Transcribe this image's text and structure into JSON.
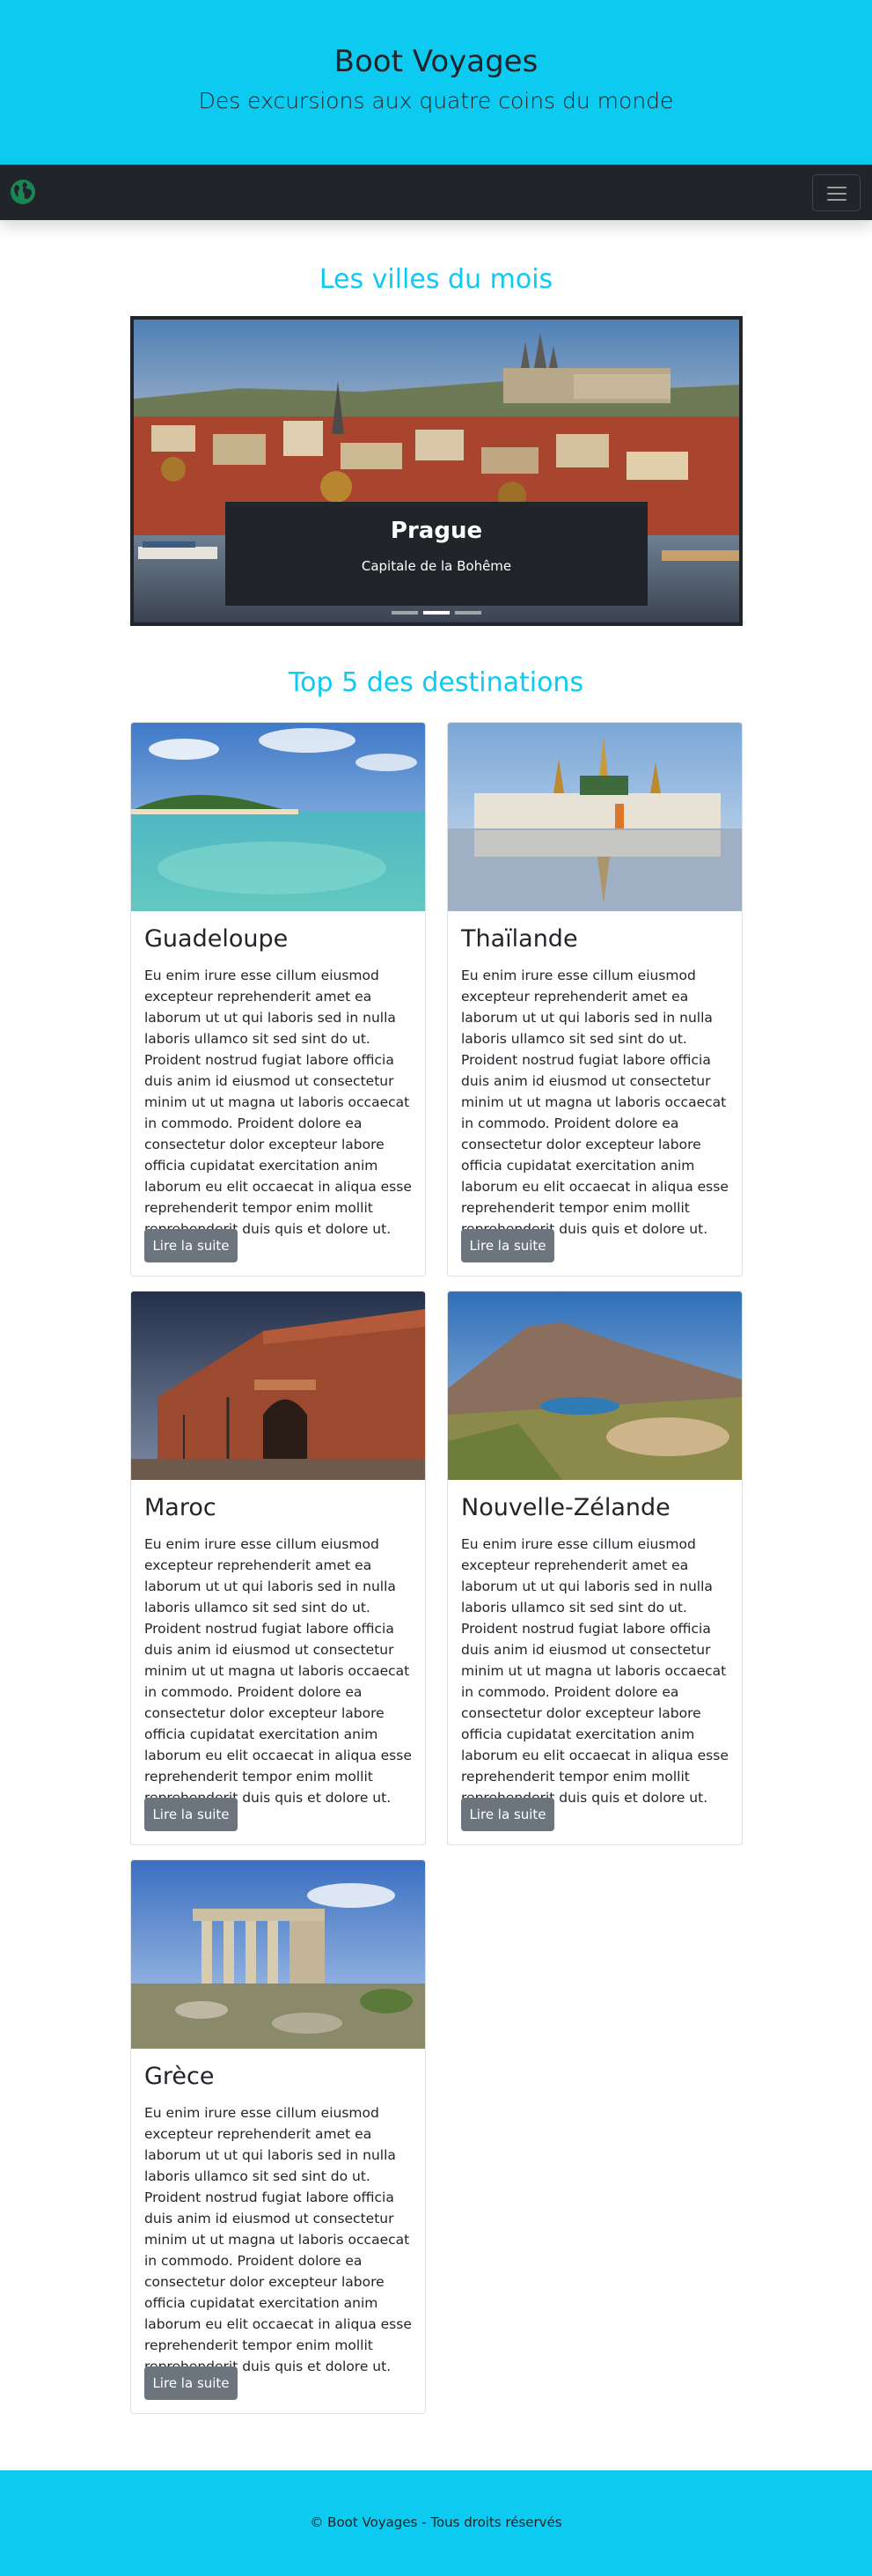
{
  "header": {
    "title": "Boot Voyages",
    "subtitle": "Des excursions aux quatre coins du monde"
  },
  "navbar": {
    "brand_icon": "globe-icon",
    "toggler_icon": "hamburger-menu-icon",
    "colors": {
      "background": "#212529",
      "brand": "#198754"
    }
  },
  "carousel": {
    "section_title": "Les villes du mois",
    "slide": {
      "title": "Prague",
      "caption": "Capitale de la Bohême"
    },
    "slides_count": 3,
    "active_index": 1
  },
  "destinations": {
    "section_title": "Top 5 des destinations",
    "cards": [
      {
        "title": "Guadeloupe",
        "text": "Eu enim irure esse cillum eiusmod excepteur reprehenderit amet ea laborum ut ut qui laboris sed in nulla laboris ullamco sit sed sint do ut. Proident nostrud fugiat labore officia duis anim id eiusmod ut consectetur minim ut ut magna ut laboris occaecat in commodo. Proident dolore ea consectetur dolor excepteur labore officia cupidatat exercitation anim laborum eu elit occaecat in aliqua esse reprehenderit tempor enim mollit reprehenderit duis quis et dolore ut.",
        "button": "Lire la suite"
      },
      {
        "title": "Thaïlande",
        "text": "Eu enim irure esse cillum eiusmod excepteur reprehenderit amet ea laborum ut ut qui laboris sed in nulla laboris ullamco sit sed sint do ut. Proident nostrud fugiat labore officia duis anim id eiusmod ut consectetur minim ut ut magna ut laboris occaecat in commodo. Proident dolore ea consectetur dolor excepteur labore officia cupidatat exercitation anim laborum eu elit occaecat in aliqua esse reprehenderit tempor enim mollit reprehenderit duis quis et dolore ut.",
        "button": "Lire la suite"
      },
      {
        "title": "Maroc",
        "text": "Eu enim irure esse cillum eiusmod excepteur reprehenderit amet ea laborum ut ut qui laboris sed in nulla laboris ullamco sit sed sint do ut. Proident nostrud fugiat labore officia duis anim id eiusmod ut consectetur minim ut ut magna ut laboris occaecat in commodo. Proident dolore ea consectetur dolor excepteur labore officia cupidatat exercitation anim laborum eu elit occaecat in aliqua esse reprehenderit tempor enim mollit reprehenderit duis quis et dolore ut.",
        "button": "Lire la suite"
      },
      {
        "title": "Nouvelle-Zélande",
        "text": "Eu enim irure esse cillum eiusmod excepteur reprehenderit amet ea laborum ut ut qui laboris sed in nulla laboris ullamco sit sed sint do ut. Proident nostrud fugiat labore officia duis anim id eiusmod ut consectetur minim ut ut magna ut laboris occaecat in commodo. Proident dolore ea consectetur dolor excepteur labore officia cupidatat exercitation anim laborum eu elit occaecat in aliqua esse reprehenderit tempor enim mollit reprehenderit duis quis et dolore ut.",
        "button": "Lire la suite"
      },
      {
        "title": "Grèce",
        "text": "Eu enim irure esse cillum eiusmod excepteur reprehenderit amet ea laborum ut ut qui laboris sed in nulla laboris ullamco sit sed sint do ut. Proident nostrud fugiat labore officia duis anim id eiusmod ut consectetur minim ut ut magna ut laboris occaecat in commodo. Proident dolore ea consectetur dolor excepteur labore officia cupidatat exercitation anim laborum eu elit occaecat in aliqua esse reprehenderit tempor enim mollit reprehenderit duis quis et dolore ut.",
        "button": "Lire la suite"
      }
    ]
  },
  "footer": {
    "text": "© Boot Voyages - Tous droits réservés"
  },
  "colors": {
    "accent": "#0dcaf0",
    "dark": "#212529",
    "button": "#6c757d"
  }
}
